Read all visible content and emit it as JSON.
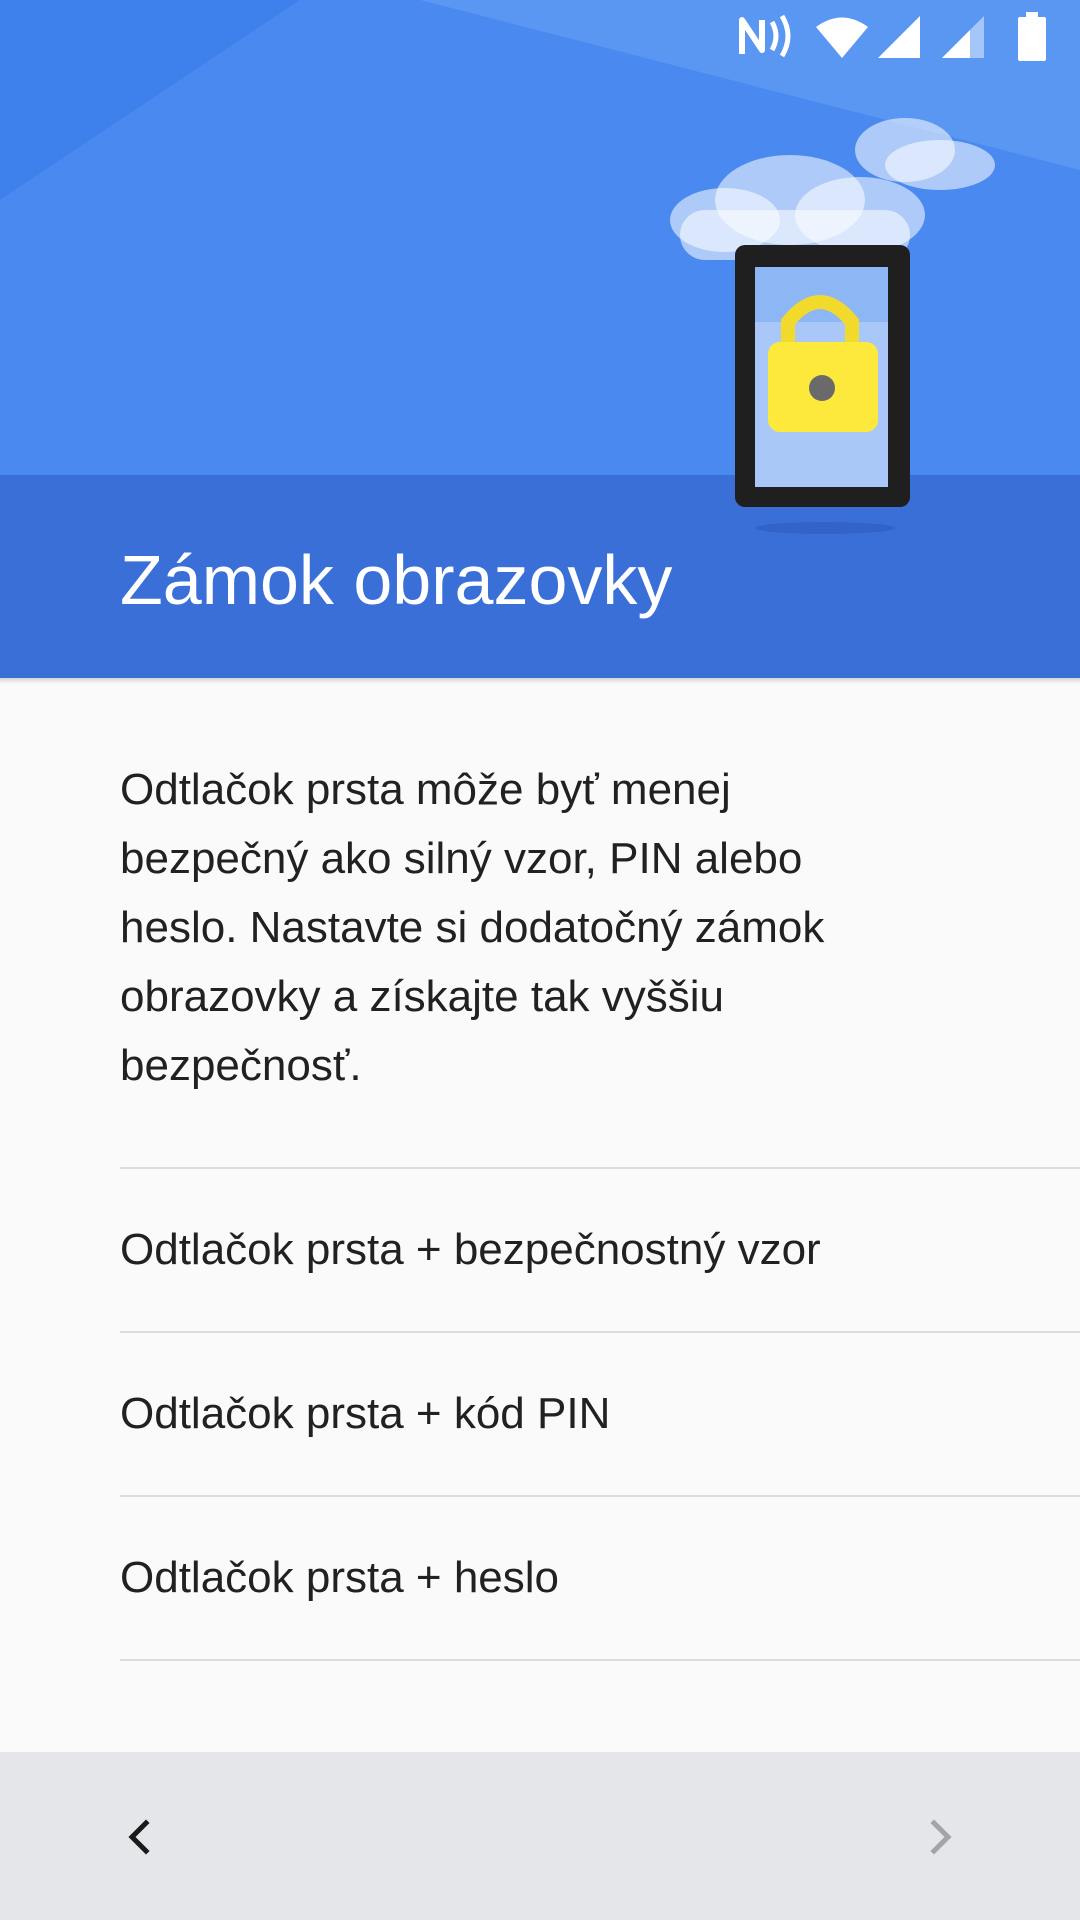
{
  "status_bar": {
    "icons": [
      "nfc-icon",
      "wifi-icon",
      "signal-icon",
      "signal-icon",
      "battery-icon"
    ]
  },
  "header": {
    "title": "Zámok obrazovky",
    "background_color": "#3a77e8",
    "illustration": "phone-lock-illustration"
  },
  "main": {
    "description": "Odtlačok prsta môže byť menej bezpečný ako silný vzor, PIN alebo heslo. Nastavte si dodatočný zámok obrazovky a získajte tak vyššiu bezpečnosť.",
    "options": [
      {
        "label": "Odtlačok prsta + bezpečnostný vzor"
      },
      {
        "label": "Odtlačok prsta + kód PIN"
      },
      {
        "label": "Odtlačok prsta + heslo"
      }
    ]
  },
  "navigation": {
    "back_icon": "chevron-left-icon",
    "next_icon": "chevron-right-icon",
    "next_enabled": false,
    "bar_color": "#e4e6e9"
  }
}
